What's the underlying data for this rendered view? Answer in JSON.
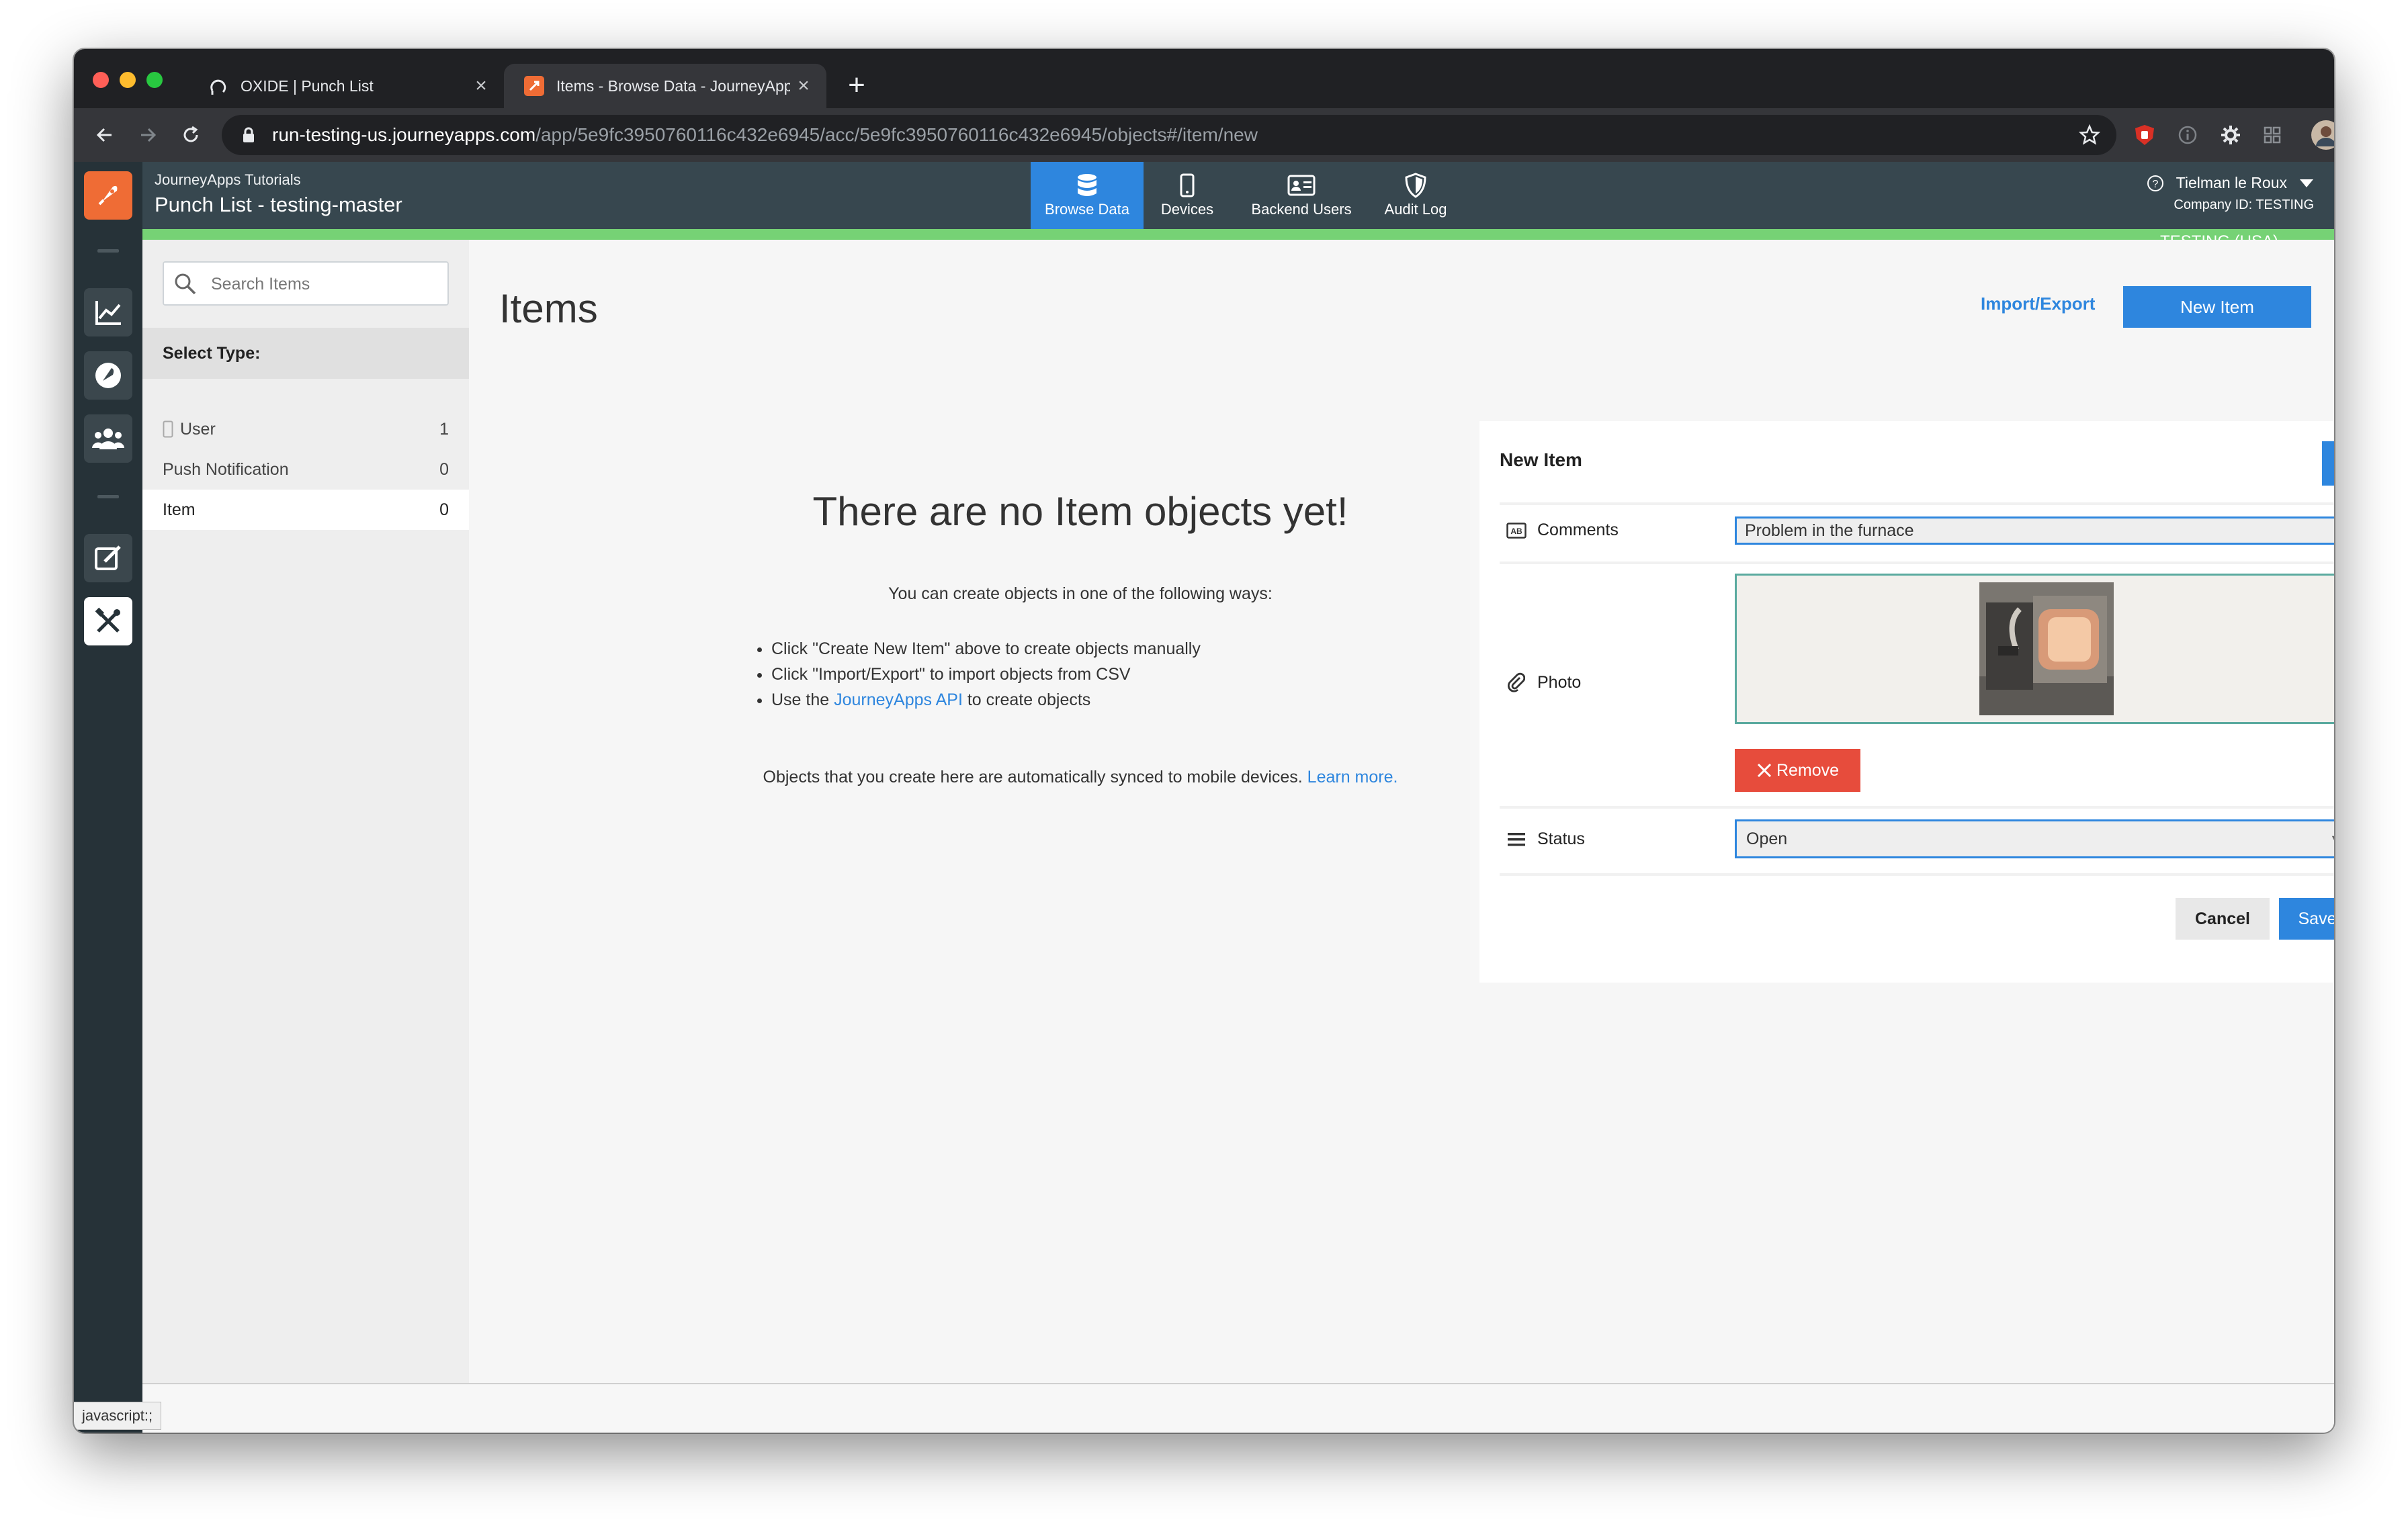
{
  "browser": {
    "tabs": [
      {
        "title": "OXIDE | Punch List"
      },
      {
        "title": "Items - Browse Data - JourneyApps"
      }
    ],
    "url_host": "run-testing-us.journeyapps.com",
    "url_path": "/app/5e9fc3950760116c432e6945/acc/5e9fc3950760116c432e6945/objects#/item/new"
  },
  "header": {
    "org": "JourneyApps Tutorials",
    "app_title": "Punch List - testing-master",
    "nav": [
      {
        "label": "Browse Data"
      },
      {
        "label": "Devices"
      },
      {
        "label": "Backend Users"
      },
      {
        "label": "Audit Log"
      }
    ],
    "user_name": "Tielman le Roux",
    "company_id": "Company ID: TESTING",
    "env_badge": "TESTING (USA)"
  },
  "left_panel": {
    "search_placeholder": "Search Items",
    "select_type_label": "Select Type:",
    "types": [
      {
        "label": "User",
        "count": "1"
      },
      {
        "label": "Push Notification",
        "count": "0"
      },
      {
        "label": "Item",
        "count": "0"
      }
    ]
  },
  "main": {
    "title": "Items",
    "import_export": "Import/Export",
    "new_item": "New Item",
    "empty_heading": "There are no Item objects yet!",
    "empty_intro": "You can create objects in one of the following ways:",
    "ways": [
      "Click \"Create New Item\" above to create objects manually",
      "Click \"Import/Export\" to import objects from CSV"
    ],
    "api_prefix": "Use the ",
    "api_link": "JourneyApps API",
    "api_suffix": " to create objects",
    "footer_text": "Objects that you create here are automatically synced to mobile devices. ",
    "learn_more": "Learn more."
  },
  "form": {
    "title": "New Item",
    "comments_label": "Comments",
    "comments_value": "Problem in the furnace",
    "photo_label": "Photo",
    "remove": "Remove",
    "status_label": "Status",
    "status_value": "Open",
    "cancel": "Cancel",
    "save": "Save"
  },
  "status_bar": "javascript:;",
  "colors": {
    "accent": "#2e86de",
    "danger": "#e74c3c",
    "env_green": "#76d275",
    "header_dark": "#37474f",
    "rail_dark": "#263238"
  }
}
